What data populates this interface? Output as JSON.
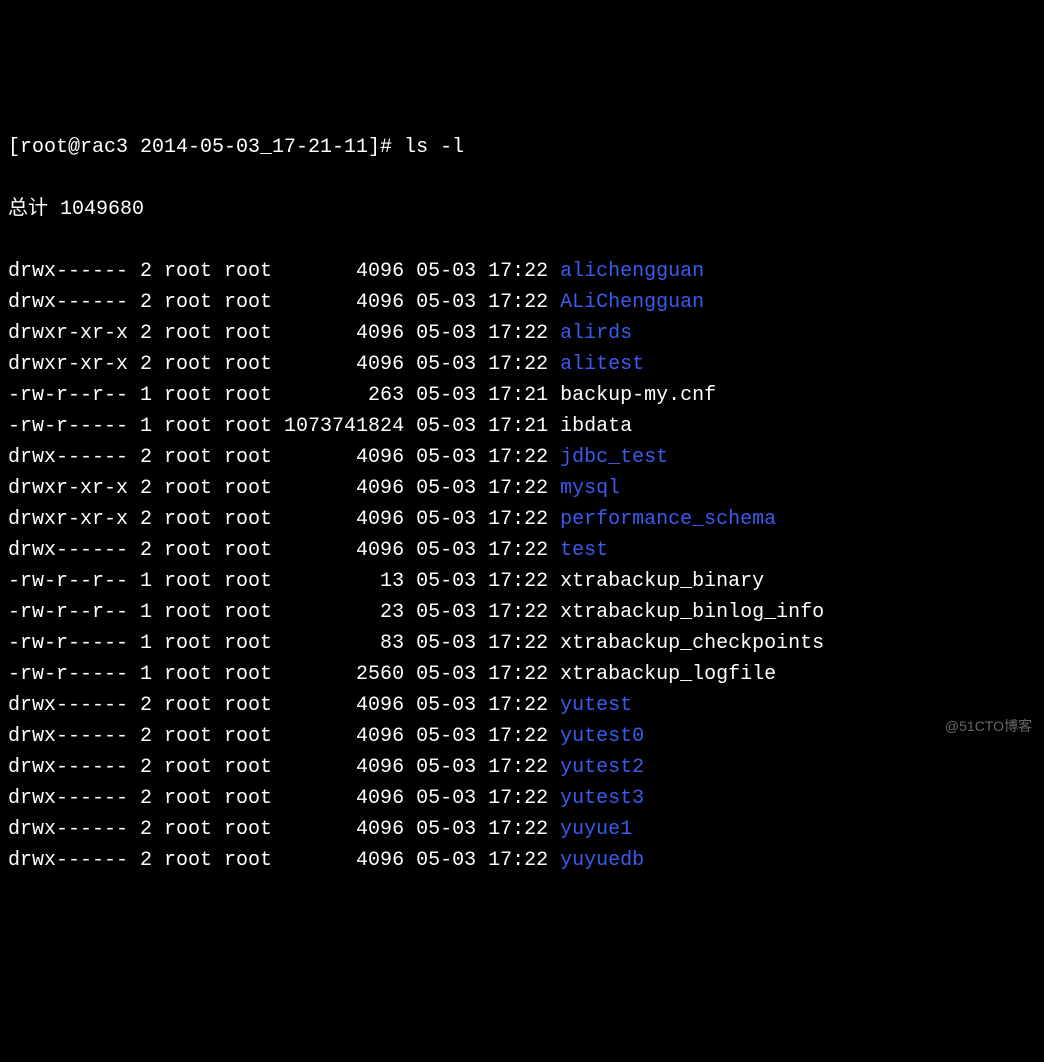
{
  "prompt": "[root@rac3 2014-05-03_17-21-11]# ls -l",
  "total": "总计 1049680",
  "watermark": "@51CTO博客",
  "entries": [
    {
      "perms": "drwx------",
      "links": "2",
      "owner": "root",
      "group": "root",
      "size": "4096",
      "date": "05-03",
      "time": "17:22",
      "name": "alichengguan",
      "type": "dir"
    },
    {
      "perms": "drwx------",
      "links": "2",
      "owner": "root",
      "group": "root",
      "size": "4096",
      "date": "05-03",
      "time": "17:22",
      "name": "ALiChengguan",
      "type": "dir"
    },
    {
      "perms": "drwxr-xr-x",
      "links": "2",
      "owner": "root",
      "group": "root",
      "size": "4096",
      "date": "05-03",
      "time": "17:22",
      "name": "alirds",
      "type": "dir"
    },
    {
      "perms": "drwxr-xr-x",
      "links": "2",
      "owner": "root",
      "group": "root",
      "size": "4096",
      "date": "05-03",
      "time": "17:22",
      "name": "alitest",
      "type": "dir"
    },
    {
      "perms": "-rw-r--r--",
      "links": "1",
      "owner": "root",
      "group": "root",
      "size": "263",
      "date": "05-03",
      "time": "17:21",
      "name": "backup-my.cnf",
      "type": "file"
    },
    {
      "perms": "-rw-r-----",
      "links": "1",
      "owner": "root",
      "group": "root",
      "size": "1073741824",
      "date": "05-03",
      "time": "17:21",
      "name": "ibdata",
      "type": "file"
    },
    {
      "perms": "drwx------",
      "links": "2",
      "owner": "root",
      "group": "root",
      "size": "4096",
      "date": "05-03",
      "time": "17:22",
      "name": "jdbc_test",
      "type": "dir"
    },
    {
      "perms": "drwxr-xr-x",
      "links": "2",
      "owner": "root",
      "group": "root",
      "size": "4096",
      "date": "05-03",
      "time": "17:22",
      "name": "mysql",
      "type": "dir"
    },
    {
      "perms": "drwxr-xr-x",
      "links": "2",
      "owner": "root",
      "group": "root",
      "size": "4096",
      "date": "05-03",
      "time": "17:22",
      "name": "performance_schema",
      "type": "dir"
    },
    {
      "perms": "drwx------",
      "links": "2",
      "owner": "root",
      "group": "root",
      "size": "4096",
      "date": "05-03",
      "time": "17:22",
      "name": "test",
      "type": "dir"
    },
    {
      "perms": "-rw-r--r--",
      "links": "1",
      "owner": "root",
      "group": "root",
      "size": "13",
      "date": "05-03",
      "time": "17:22",
      "name": "xtrabackup_binary",
      "type": "file"
    },
    {
      "perms": "-rw-r--r--",
      "links": "1",
      "owner": "root",
      "group": "root",
      "size": "23",
      "date": "05-03",
      "time": "17:22",
      "name": "xtrabackup_binlog_info",
      "type": "file"
    },
    {
      "perms": "-rw-r-----",
      "links": "1",
      "owner": "root",
      "group": "root",
      "size": "83",
      "date": "05-03",
      "time": "17:22",
      "name": "xtrabackup_checkpoints",
      "type": "file"
    },
    {
      "perms": "-rw-r-----",
      "links": "1",
      "owner": "root",
      "group": "root",
      "size": "2560",
      "date": "05-03",
      "time": "17:22",
      "name": "xtrabackup_logfile",
      "type": "file"
    },
    {
      "perms": "drwx------",
      "links": "2",
      "owner": "root",
      "group": "root",
      "size": "4096",
      "date": "05-03",
      "time": "17:22",
      "name": "yutest",
      "type": "dir"
    },
    {
      "perms": "drwx------",
      "links": "2",
      "owner": "root",
      "group": "root",
      "size": "4096",
      "date": "05-03",
      "time": "17:22",
      "name": "yutest0",
      "type": "dir"
    },
    {
      "perms": "drwx------",
      "links": "2",
      "owner": "root",
      "group": "root",
      "size": "4096",
      "date": "05-03",
      "time": "17:22",
      "name": "yutest2",
      "type": "dir"
    },
    {
      "perms": "drwx------",
      "links": "2",
      "owner": "root",
      "group": "root",
      "size": "4096",
      "date": "05-03",
      "time": "17:22",
      "name": "yutest3",
      "type": "dir"
    },
    {
      "perms": "drwx------",
      "links": "2",
      "owner": "root",
      "group": "root",
      "size": "4096",
      "date": "05-03",
      "time": "17:22",
      "name": "yuyue1",
      "type": "dir"
    },
    {
      "perms": "drwx------",
      "links": "2",
      "owner": "root",
      "group": "root",
      "size": "4096",
      "date": "05-03",
      "time": "17:22",
      "name": "yuyuedb",
      "type": "dir"
    }
  ]
}
